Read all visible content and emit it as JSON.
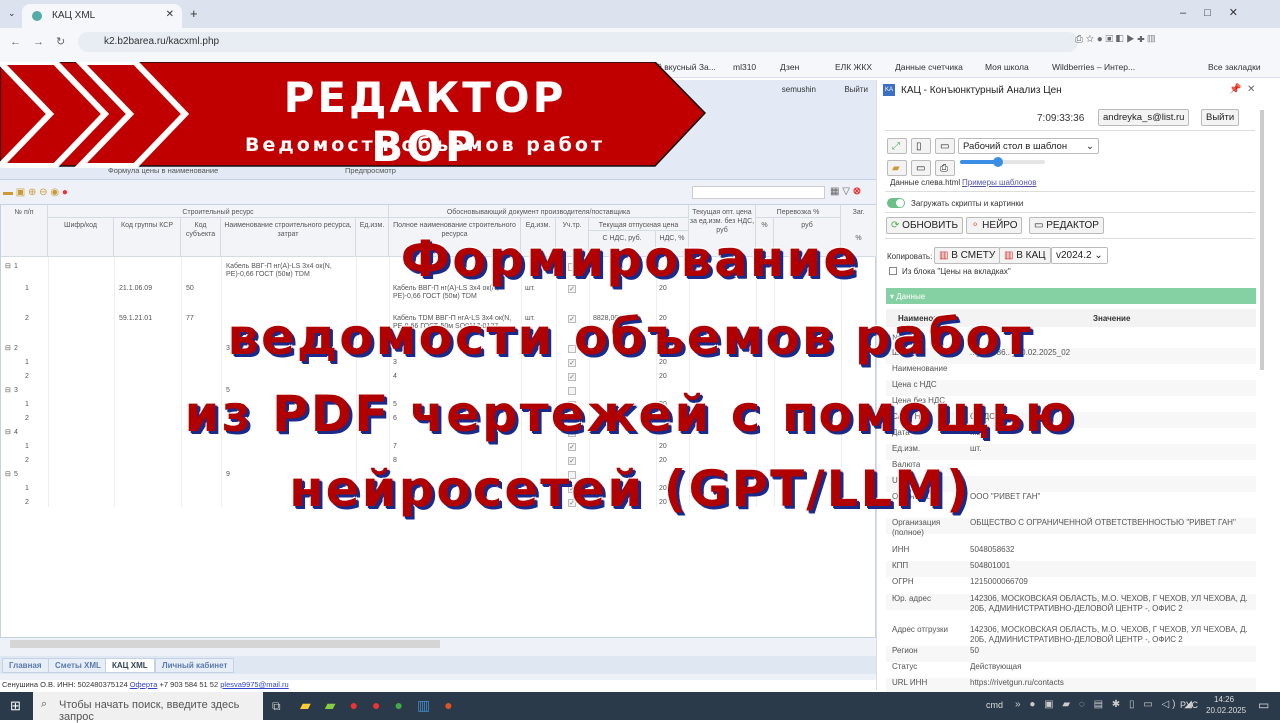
{
  "browser": {
    "tab_title": "КАЦ XML",
    "url": "k2.b2barea.ru/kacxml.php",
    "bookmarks": [
      "...й вкусный За...",
      "ml310",
      "Дзен",
      "ЕЛК ЖКХ",
      "Данные счетчика",
      "Моя школа",
      "Wildberries – Интер...",
      "Все закладки"
    ]
  },
  "app": {
    "user": "semushin",
    "logout": "Выйти",
    "ribbon": {
      "formula": "Формула цены в наименование",
      "preview": "Предпросмотр"
    },
    "table": {
      "group_headers": [
        "№ п/п",
        "Строительный ресурс",
        "Обосновывающий документ производителя/поставщика",
        "Текущая опт. цена за ед.изм. без НДС, руб",
        "Перевозка %",
        "Заг."
      ],
      "sub_headers": [
        "Шифр/код",
        "Код группы КСР",
        "Код субъекта",
        "Наименование строительного ресурса, затрат",
        "Ед.изм.",
        "Полное наименование строительного ресурса",
        "Ед.изм.",
        "Уч.тр.",
        "Текущая отпускная цена",
        "С НДС, руб.",
        "НДС, %",
        "%",
        "руб",
        "%"
      ],
      "rows": [
        {
          "n": "1",
          "group": true,
          "name": "Кабель ВВГ-П нг(А)-LS 3х4 ок(N, PE)-0,66 ГОСТ (50м) TDM",
          "full": "",
          "unit2": "",
          "checked": false,
          "price": "",
          "vat": ""
        },
        {
          "n": "1",
          "ksr": "21.1.06.09",
          "subj": "50",
          "full": "Кабель ВВГ-П нг(А)-LS 3х4 ок(N, PE)-0,66 ГОСТ (50м) TDM",
          "unit2": "шт.",
          "checked": true,
          "price": "",
          "vat": "20"
        },
        {
          "n": "2",
          "ksr": "59.1.21.01",
          "subj": "77",
          "full": "Кабель TDM ВВГ-П нгА-LS 3х4 ок(N, PE-0,66 ГОСТ-50м SQ0117-0127",
          "unit2": "шт.",
          "checked": true,
          "price": "8828,00",
          "vat": "20"
        },
        {
          "n": "2",
          "group": true,
          "name": "3",
          "checked": false
        },
        {
          "n": "1",
          "full": "3",
          "checked": true,
          "vat": "20"
        },
        {
          "n": "2",
          "full": "4",
          "checked": true,
          "vat": "20"
        },
        {
          "n": "3",
          "group": true,
          "name": "5",
          "checked": false
        },
        {
          "n": "1",
          "full": "5",
          "checked": true,
          "vat": "20"
        },
        {
          "n": "2",
          "full": "6",
          "checked": true,
          "vat": "20"
        },
        {
          "n": "4",
          "group": true,
          "checked": false
        },
        {
          "n": "1",
          "full": "7",
          "checked": true,
          "vat": "20"
        },
        {
          "n": "2",
          "full": "8",
          "checked": true,
          "vat": "20"
        },
        {
          "n": "5",
          "group": true,
          "name": "9",
          "checked": false
        },
        {
          "n": "1",
          "checked": true,
          "vat": "20"
        },
        {
          "n": "2",
          "checked": true,
          "vat": "20"
        }
      ]
    },
    "bottom_tabs": [
      "Главная",
      "Сметы XML",
      "КАЦ XML",
      "Личный кабинет"
    ],
    "status": {
      "text": "Сенушина О.В. ИНН: 502480375124",
      "offer": "Оферта",
      "phone": "+7 903 584 51 52",
      "email": "plesva9975@mail.ru"
    }
  },
  "panel": {
    "title": "КАЦ - Конъюнктурный Анализ Цен",
    "time": "7:09:33:36",
    "user": "andreyka_s@list.ru",
    "logout": "Выйти",
    "template_select": "Рабочий стол в шаблон",
    "data_left": "Данные слева.html",
    "examples": "Примеры шаблонов",
    "slider_value": 0.45,
    "toggle_label": "Загружать скрипты и картинки",
    "btn_refresh": "ОБНОВИТЬ",
    "btn_neuro": "НЕЙРО",
    "btn_editor": "РЕДАКТОР",
    "copy_label": "Копировать:",
    "btn_smeta": "В СМЕТУ",
    "btn_kac": "В КАЦ",
    "version": "v2024.2",
    "from_block": "Из блока \"Цены на вкладках\"",
    "section": "Данные",
    "col_name": "Наименование",
    "col_value": "Значение",
    "fields": [
      {
        "k": "№ п/п",
        "v": ""
      },
      {
        "k": "Шифр",
        "v": "..._5...586..._20.02.2025_02"
      },
      {
        "k": "Наименование",
        "v": ""
      },
      {
        "k": "Цена с НДС",
        "v": ""
      },
      {
        "k": "Цена без НДС",
        "v": ""
      },
      {
        "k": "С/без НДС",
        "v": "С НДС"
      },
      {
        "k": "Дата",
        "v": "...2..."
      },
      {
        "k": "Ед.изм.",
        "v": "шт."
      },
      {
        "k": "Валюта",
        "v": ""
      },
      {
        "k": "URL",
        "v": ""
      },
      {
        "k": "Организация",
        "v": "ООО \"РИВЕТ ГАН\""
      },
      {
        "k": "Организация (полное)",
        "v": "ОБЩЕСТВО С ОГРАНИЧЕННОЙ ОТВЕТСТВЕННОСТЬЮ \"РИВЕТ ГАН\""
      },
      {
        "k": "ИНН",
        "v": "5048058632"
      },
      {
        "k": "КПП",
        "v": "504801001"
      },
      {
        "k": "ОГРН",
        "v": "1215000066709"
      },
      {
        "k": "Юр. адрес",
        "v": "142306, МОСКОВСКАЯ ОБЛАСТЬ, М.О. ЧЕХОВ, Г ЧЕХОВ, УЛ ЧЕХОВА, Д. 20Б, АДМИНИСТРАТИВНО-ДЕЛОВОЙ ЦЕНТР -, ОФИС 2"
      },
      {
        "k": "Адрес отгрузки",
        "v": "142306, МОСКОВСКАЯ ОБЛАСТЬ, М.О. ЧЕХОВ, Г ЧЕХОВ, УЛ ЧЕХОВА, Д. 20Б, АДМИНИСТРАТИВНО-ДЕЛОВОЙ ЦЕНТР -, ОФИС 2"
      },
      {
        "k": "Регион",
        "v": "50"
      },
      {
        "k": "Статус",
        "v": "Действующая"
      },
      {
        "k": "URL ИНН",
        "v": "https://rivetgun.ru/contacts"
      }
    ]
  },
  "overlay": {
    "banner_title": "РЕДАКТОР ВОР",
    "banner_subtitle": "Ведомости объемов работ",
    "lines": [
      "Формирование",
      "ведомости объемов работ",
      "из PDF чертежей с помощью",
      "нейросетей (GPT/LLM)"
    ]
  },
  "taskbar": {
    "search_placeholder": "Чтобы начать поиск, введите здесь запрос",
    "cmd": "cmd",
    "lang": "РУС",
    "time": "14:26",
    "date": "20.02.2025"
  },
  "colors": {
    "banner": "#c00000",
    "accent_green": "#86d1a3"
  }
}
